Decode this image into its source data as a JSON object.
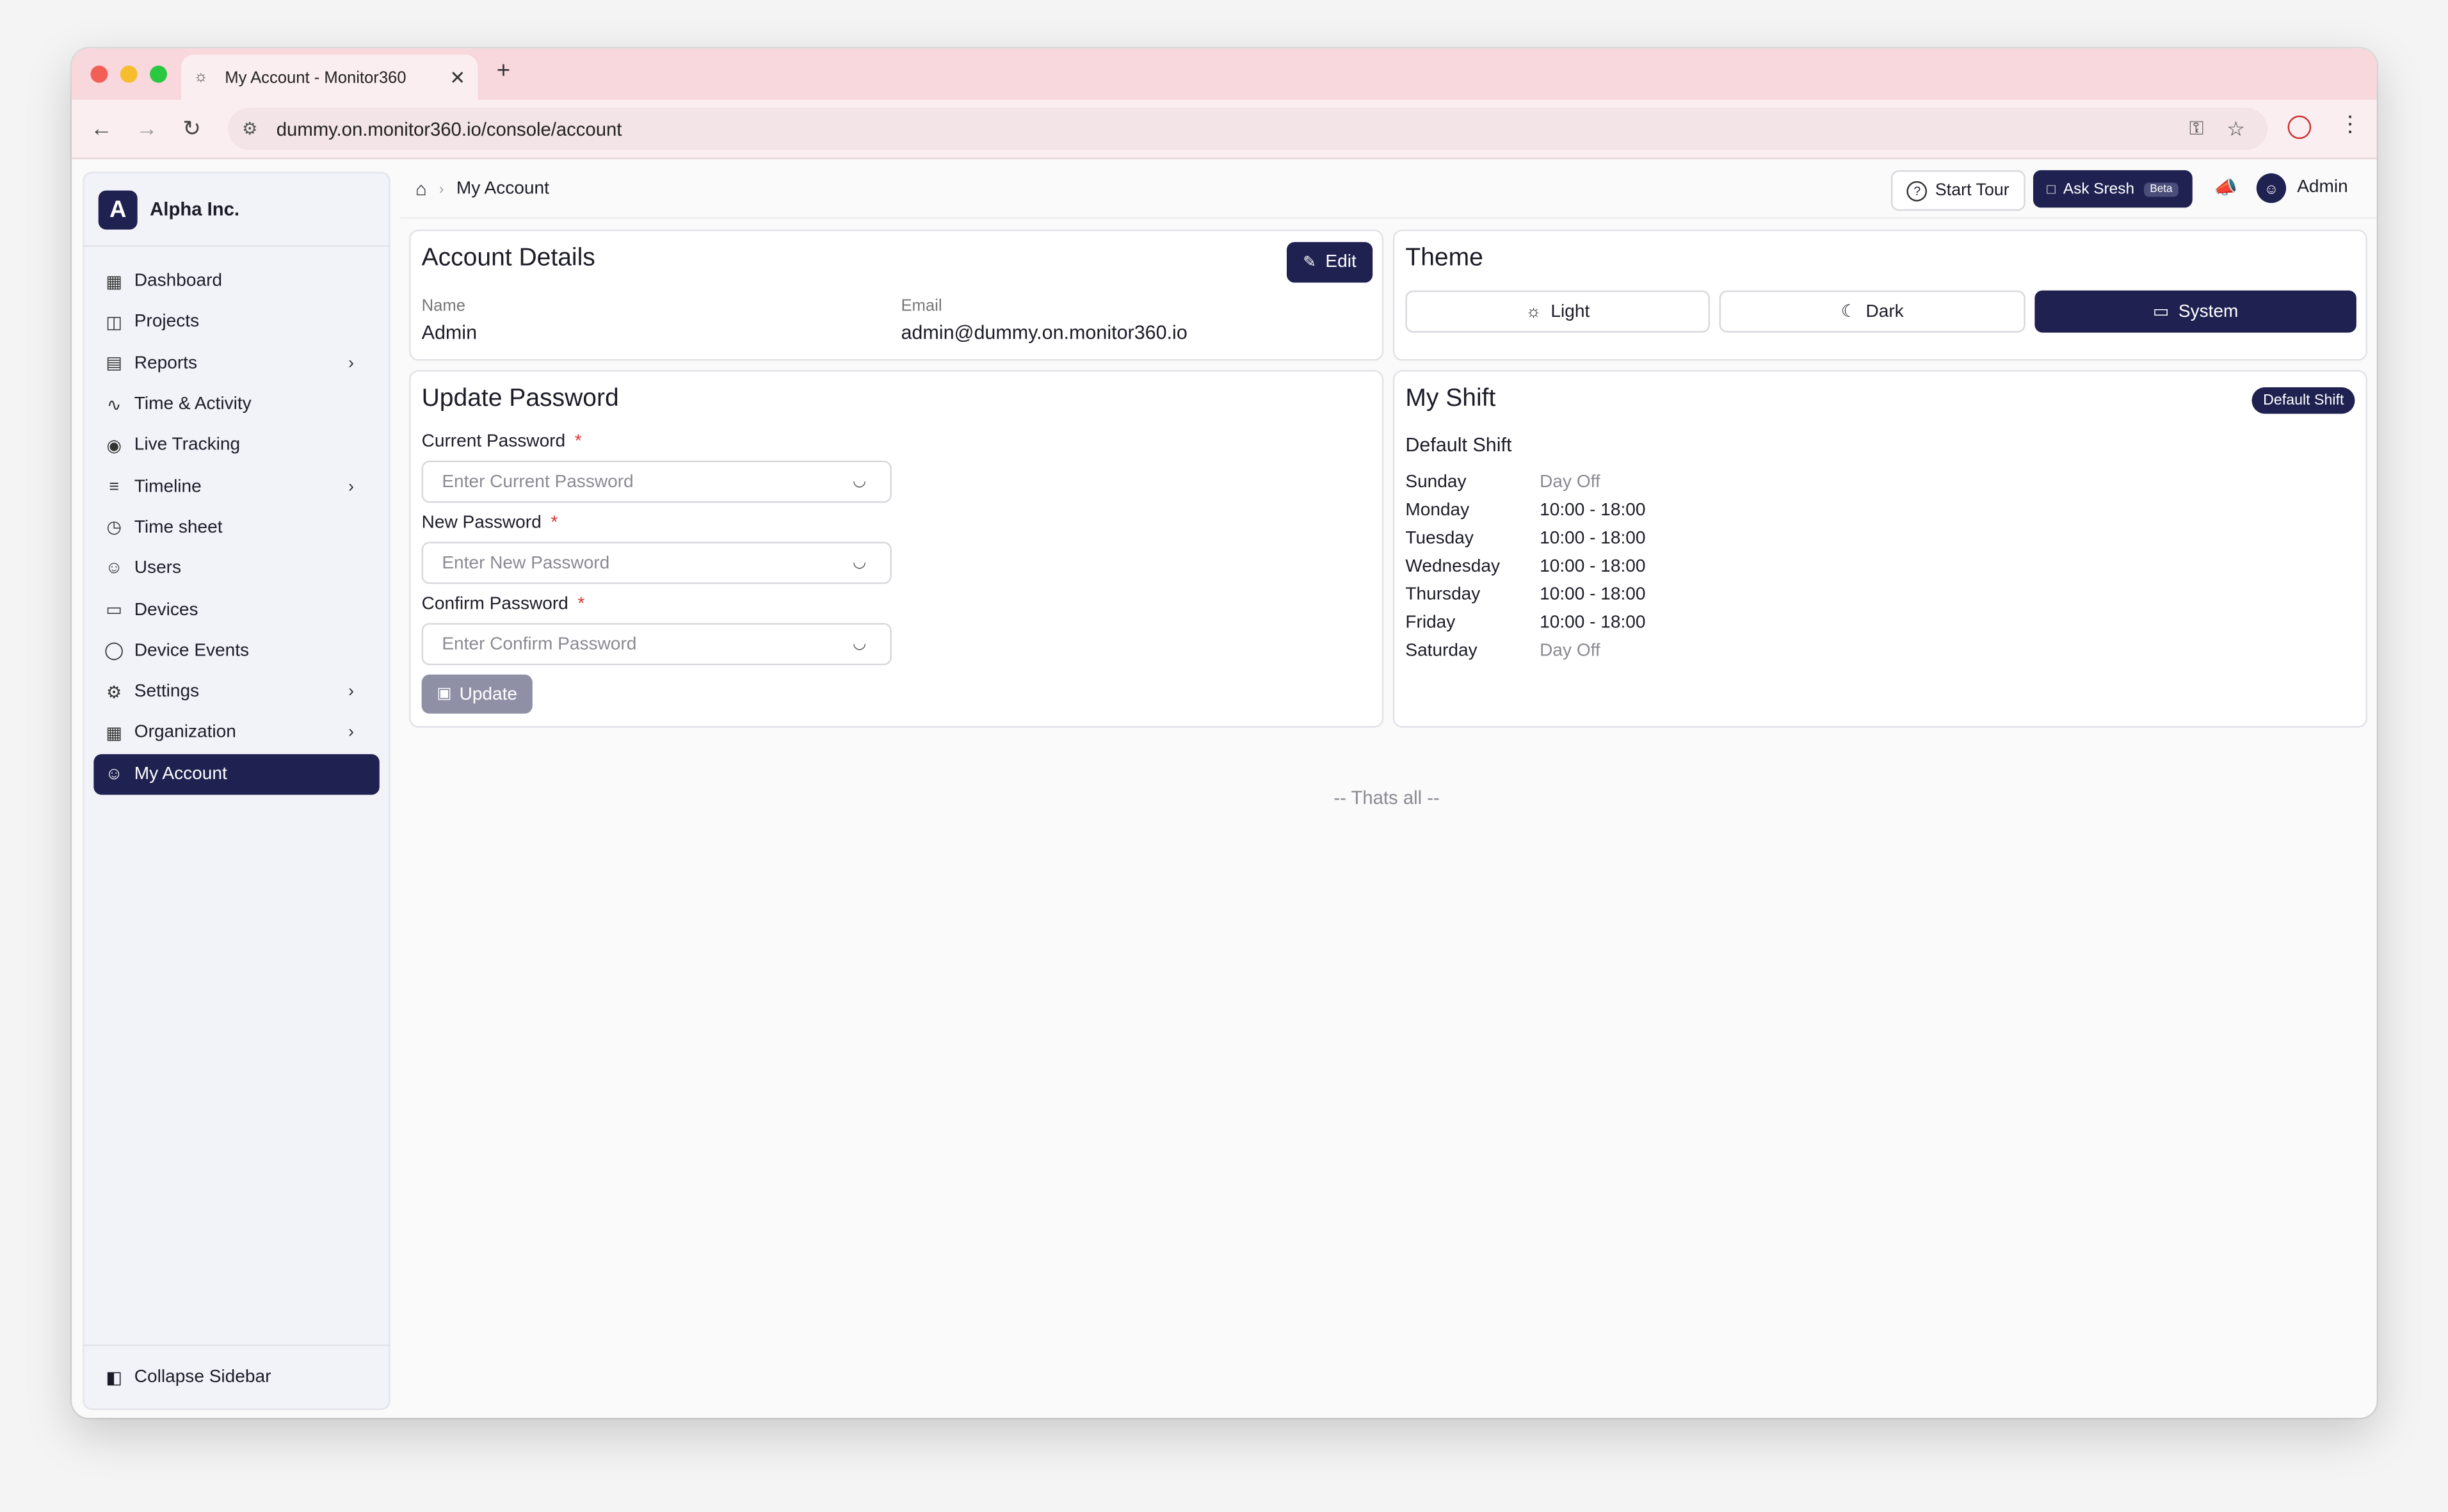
{
  "browser": {
    "tab_title": "My Account - Monitor360",
    "url": "dummy.on.monitor360.io/console/account"
  },
  "sidebar": {
    "org_initial": "A",
    "org_name": "Alpha Inc.",
    "items": [
      {
        "label": "Dashboard",
        "icon": "dashboard-icon"
      },
      {
        "label": "Projects",
        "icon": "folder-icon"
      },
      {
        "label": "Reports",
        "icon": "report-icon"
      },
      {
        "label": "Time & Activity",
        "icon": "activity-icon"
      },
      {
        "label": "Live Tracking",
        "icon": "broadcast-icon"
      },
      {
        "label": "Timeline",
        "icon": "timeline-icon"
      },
      {
        "label": "Time sheet",
        "icon": "timer-icon"
      },
      {
        "label": "Users",
        "icon": "users-icon"
      },
      {
        "label": "Devices",
        "icon": "monitor-icon"
      },
      {
        "label": "Device Events",
        "icon": "shield-icon"
      },
      {
        "label": "Settings",
        "icon": "gear-icon"
      },
      {
        "label": "Organization",
        "icon": "building-icon"
      },
      {
        "label": "My Account",
        "icon": "user-icon"
      }
    ],
    "collapse_label": "Collapse Sidebar"
  },
  "header": {
    "breadcrumb_current": "My Account",
    "start_tour": "Start Tour",
    "ask_label": "Ask Sresh",
    "beta": "Beta",
    "user_name": "Admin"
  },
  "account": {
    "title": "Account Details",
    "edit": "Edit",
    "name_label": "Name",
    "name_value": "Admin",
    "email_label": "Email",
    "email_value": "admin@dummy.on.monitor360.io"
  },
  "theme": {
    "title": "Theme",
    "options": [
      "Light",
      "Dark",
      "System"
    ],
    "selected": "System"
  },
  "password": {
    "title": "Update Password",
    "current_label": "Current Password",
    "current_placeholder": "Enter Current Password",
    "new_label": "New Password",
    "new_placeholder": "Enter New Password",
    "confirm_label": "Confirm Password",
    "confirm_placeholder": "Enter Confirm Password",
    "required_mark": "*",
    "update": "Update"
  },
  "shift": {
    "title": "My Shift",
    "badge": "Default Shift",
    "name": "Default Shift",
    "days": [
      {
        "day": "Sunday",
        "time": "Day Off"
      },
      {
        "day": "Monday",
        "time": "10:00 - 18:00"
      },
      {
        "day": "Tuesday",
        "time": "10:00 - 18:00"
      },
      {
        "day": "Wednesday",
        "time": "10:00 - 18:00"
      },
      {
        "day": "Thursday",
        "time": "10:00 - 18:00"
      },
      {
        "day": "Friday",
        "time": "10:00 - 18:00"
      },
      {
        "day": "Saturday",
        "time": "Day Off"
      }
    ]
  },
  "footer": {
    "note": "-- Thats all --"
  }
}
